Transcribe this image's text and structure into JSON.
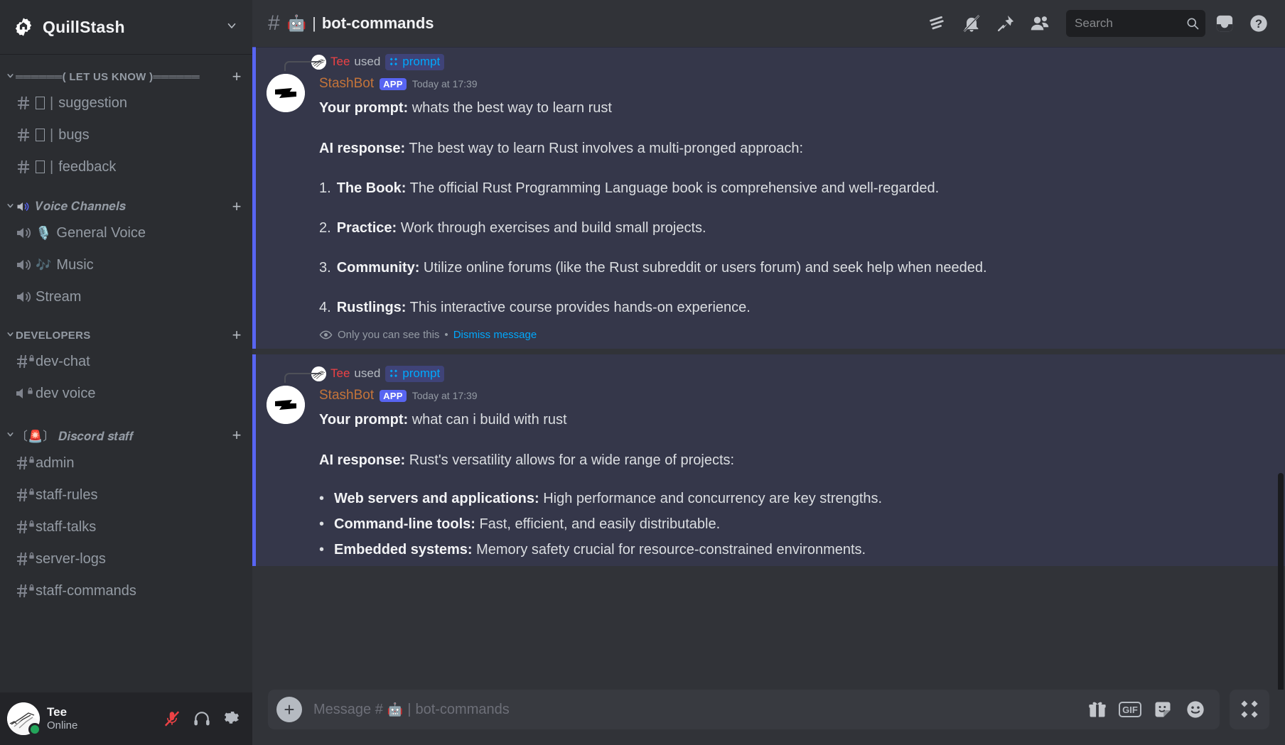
{
  "server": {
    "name": "QuillStash",
    "icon": "gear-burst-icon",
    "dropdown_icon": "chevron-down-icon"
  },
  "sidebar": {
    "categories": [
      {
        "name": "══════( LET US KNOW )══════",
        "style": "plain",
        "add_label": "+",
        "channels": [
          {
            "type": "text",
            "emoji": "☐",
            "name": "suggestion",
            "private": false
          },
          {
            "type": "text",
            "emoji": "☐",
            "name": "bugs",
            "private": false
          },
          {
            "type": "text",
            "emoji": "☐",
            "name": "feedback",
            "private": false
          }
        ]
      },
      {
        "name": "𝑽𝒐𝒊𝒄𝒆 𝑪𝒉𝒂𝒏𝒏𝒆𝒍𝒔",
        "style": "fancy",
        "prefix_icon": "speaker-icon",
        "add_label": "+",
        "channels": [
          {
            "type": "voice",
            "emoji": "🎙️",
            "name": "General Voice",
            "private": false
          },
          {
            "type": "voice",
            "emoji": "🎶",
            "name": "Music",
            "private": false
          },
          {
            "type": "voice",
            "emoji": "",
            "name": "Stream",
            "private": false
          }
        ]
      },
      {
        "name": "DEVELOPERS",
        "style": "plain",
        "add_label": "+",
        "channels": [
          {
            "type": "text",
            "emoji": "",
            "name": "dev-chat",
            "private": true
          },
          {
            "type": "voice",
            "emoji": "",
            "name": "dev voice",
            "private": true
          }
        ]
      },
      {
        "name": "〔🚨〕 𝑫𝒊𝒔𝒄𝒐𝒓𝒅 𝒔𝒕𝒂𝒇𝒇",
        "style": "fancy-bracket",
        "add_label": "+",
        "channels": [
          {
            "type": "text",
            "emoji": "",
            "name": "admin",
            "private": true
          },
          {
            "type": "text",
            "emoji": "",
            "name": "staff-rules",
            "private": true
          },
          {
            "type": "text",
            "emoji": "",
            "name": "staff-talks",
            "private": true
          },
          {
            "type": "text",
            "emoji": "",
            "name": "server-logs",
            "private": true
          },
          {
            "type": "text",
            "emoji": "",
            "name": "staff-commands",
            "private": true
          }
        ]
      }
    ]
  },
  "user_panel": {
    "name": "Tee",
    "status": "Online",
    "status_color": "#23a55a",
    "buttons": [
      {
        "icon": "microphone-muted-icon",
        "muted": true
      },
      {
        "icon": "headphones-icon",
        "muted": false
      },
      {
        "icon": "gear-icon",
        "muted": false
      }
    ]
  },
  "topbar": {
    "hash": "#",
    "channel_emoji": "🤖",
    "separator": "|",
    "channel_name": "bot-commands",
    "icons": [
      "threads-icon",
      "bell-muted-icon",
      "pin-icon",
      "members-icon"
    ],
    "search": {
      "placeholder": "Search",
      "icon": "search-icon"
    },
    "inbox_icon": "inbox-icon",
    "help_icon": "help-icon"
  },
  "messages": [
    {
      "command_line": {
        "user": "Tee",
        "user_color": "#ed4245",
        "used_text": "used",
        "command": "prompt",
        "command_icon": "app-command-icon"
      },
      "author": "StashBot",
      "author_color": "#c4743a",
      "app_badge": "APP",
      "timestamp": "Today at 17:39",
      "prompt_label": "Your prompt:",
      "prompt_text": "whats the best way to learn rust",
      "response_label": "AI response:",
      "response_text": "The best way to learn Rust involves a multi-pronged approach:",
      "list_type": "ordered",
      "items": [
        {
          "num": "1.",
          "title": "The Book:",
          "text": "The official Rust Programming Language book is comprehensive and well-regarded."
        },
        {
          "num": "2.",
          "title": "Practice:",
          "text": "Work through exercises and build small projects."
        },
        {
          "num": "3.",
          "title": "Community:",
          "text": "Utilize online forums (like the Rust subreddit or users forum) and seek help when needed."
        },
        {
          "num": "4.",
          "title": "Rustlings:",
          "text": "This interactive course provides hands-on experience."
        }
      ],
      "ephemeral": {
        "icon": "eye-icon",
        "text": "Only you can see this",
        "separator": "•",
        "dismiss": "Dismiss message"
      }
    },
    {
      "command_line": {
        "user": "Tee",
        "user_color": "#ed4245",
        "used_text": "used",
        "command": "prompt",
        "command_icon": "app-command-icon"
      },
      "author": "StashBot",
      "author_color": "#c4743a",
      "app_badge": "APP",
      "timestamp": "Today at 17:39",
      "prompt_label": "Your prompt:",
      "prompt_text": "what can i build with rust",
      "response_label": "AI response:",
      "response_text": "Rust's versatility allows for a wide range of projects:",
      "list_type": "bullet",
      "items": [
        {
          "num": "•",
          "title": "Web servers and applications:",
          "text": "High performance and concurrency are key strengths."
        },
        {
          "num": "•",
          "title": "Command-line tools:",
          "text": "Fast, efficient, and easily distributable."
        },
        {
          "num": "•",
          "title": "Embedded systems:",
          "text": "Memory safety crucial for resource-constrained environments."
        }
      ]
    }
  ],
  "composer": {
    "add_label": "+",
    "placeholder_prefix": "Message #",
    "placeholder_emoji": "🤖",
    "placeholder_separator": "|",
    "placeholder_channel": "bot-commands",
    "icons": [
      "gift-icon",
      "gif-icon",
      "sticker-icon",
      "emoji-icon"
    ],
    "gif_label": "GIF",
    "apps_icon": "apps-grid-icon"
  },
  "colors": {
    "accent": "#5865f2",
    "link": "#00a8fc",
    "sidebar_bg": "#2b2d31",
    "main_bg": "#313338",
    "ephemeral_bg": "#35374a"
  }
}
